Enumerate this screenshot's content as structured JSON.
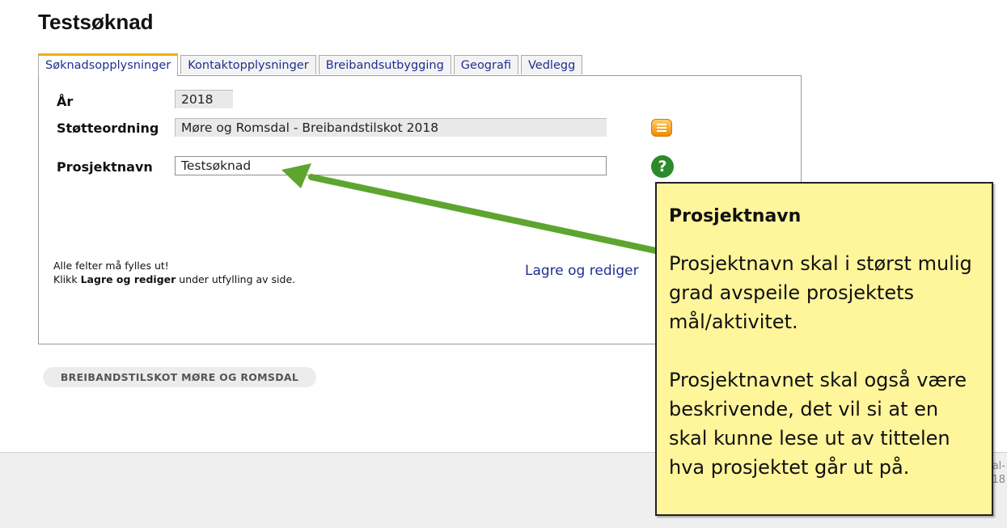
{
  "page": {
    "title": "Testsøknad"
  },
  "tabs": [
    {
      "label": "Søknadsopplysninger",
      "active": true
    },
    {
      "label": "Kontaktopplysninger",
      "active": false
    },
    {
      "label": "Breibandsutbygging",
      "active": false
    },
    {
      "label": "Geografi",
      "active": false
    },
    {
      "label": "Vedlegg",
      "active": false
    }
  ],
  "form": {
    "year_label": "År",
    "year_value": "2018",
    "scheme_label": "Støtteordning",
    "scheme_value": "Møre og Romsdal - Breibandstilskot 2018",
    "project_label": "Prosjektnavn",
    "project_value": "Testsøknad",
    "note_line1": "Alle felter må fylles ut!",
    "note_line2_prefix": "Klikk ",
    "note_line2_bold": "Lagre og rediger",
    "note_line2_suffix": " under utfylling av side.",
    "save_link": "Lagre og rediger"
  },
  "footer": {
    "pill_label": "BREIBANDSTILSKOT MØRE OG ROMSDAL",
    "snip_line1": "al-",
    "snip_line2": "18"
  },
  "callout": {
    "title": "Prosjektnavn",
    "paragraph1": "Prosjektnavn skal i størst mulig grad avspeile prosjektets mål/aktivitet.",
    "paragraph2": "Prosjektnavnet skal også være beskrivende, det vil si at en skal kunne lese ut av tittelen hva prosjektet går ut på."
  },
  "icons": {
    "scheme_info": "document-list-icon",
    "project_help": "help-icon"
  },
  "colors": {
    "arrow": "#5ea52f",
    "callout_bg": "#fff59b",
    "tab_accent": "#f0b000",
    "link": "#1f2f8f"
  }
}
